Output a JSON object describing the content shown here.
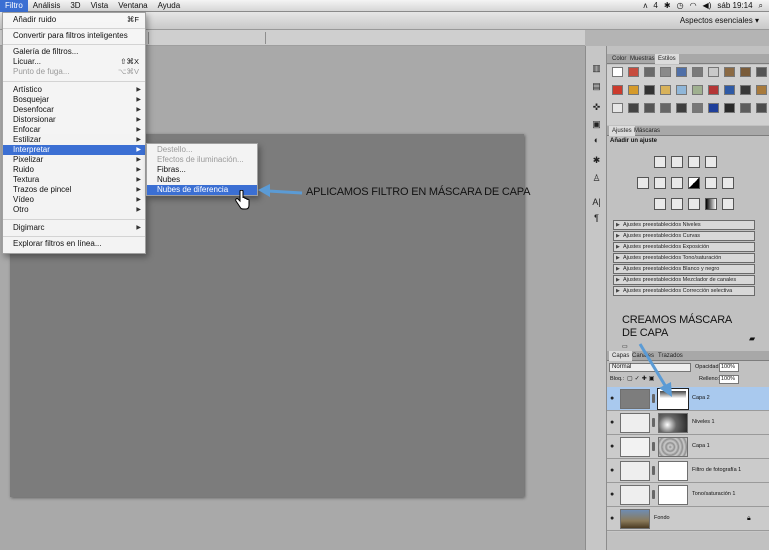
{
  "menubar": {
    "items": [
      "Filtro",
      "Análisis",
      "3D",
      "Vista",
      "Ventana",
      "Ayuda"
    ],
    "status": [
      "4",
      "sáb 19:14"
    ]
  },
  "appbar": {
    "workspace_label": "Aspectos esenciales ▾"
  },
  "filter_menu": {
    "top": [
      {
        "label": "Añadir ruido",
        "shortcut": "⌘F"
      },
      {
        "label": "Convertir para filtros inteligentes"
      },
      {
        "label": "Galería de filtros..."
      },
      {
        "label": "Licuar...",
        "shortcut": "⇧⌘X"
      },
      {
        "label": "Punto de fuga...",
        "shortcut": "⌥⌘V",
        "disabled": true
      }
    ],
    "groups": [
      "Artístico",
      "Bosquejar",
      "Desenfocar",
      "Distorsionar",
      "Enfocar",
      "Estilizar",
      "Interpretar",
      "Pixelizar",
      "Ruido",
      "Textura",
      "Trazos de pincel",
      "Vídeo",
      "Otro"
    ],
    "highlighted": "Interpretar",
    "bottom": [
      "Digimarc",
      "Explorar filtros en línea..."
    ]
  },
  "sub_menu": {
    "items": [
      {
        "label": "Destello...",
        "disabled": true
      },
      {
        "label": "Efectos de iluminación...",
        "disabled": true
      },
      {
        "label": "Fibras..."
      },
      {
        "label": "Nubes"
      },
      {
        "label": "Nubes de diferencia",
        "highlighted": true
      }
    ]
  },
  "annotations": {
    "apply": "APLICAMOS FILTRO EN MÁSCARA DE CAPA",
    "create_line1": "CREAMOS MÁSCARA",
    "create_line2": "DE CAPA"
  },
  "swatches_panel": {
    "tabs": [
      "Color",
      "Muestras",
      "Estilos"
    ],
    "active_tab": "Estilos"
  },
  "adjustments_panel": {
    "tabs": [
      "Ajustes",
      "Máscaras"
    ],
    "active_tab": "Ajustes",
    "heading": "Añadir un ajuste",
    "presets": [
      "Ajustes preestablecidos Niveles",
      "Ajustes preestablecidos Curvas",
      "Ajustes preestablecidos Exposición",
      "Ajustes preestablecidos Tono/saturación",
      "Ajustes preestablecidos Blanco y negro",
      "Ajustes preestablecidos Mezclador de canales",
      "Ajustes preestablecidos Corrección selectiva"
    ]
  },
  "layers_panel": {
    "tabs": [
      "Capas",
      "Canales",
      "Trazados"
    ],
    "active_tab": "Capas",
    "blend_mode": "Normal",
    "opacity_label": "Opacidad:",
    "opacity": "100%",
    "lock_label": "Bloq.:",
    "fill_label": "Relleno:",
    "fill": "100%",
    "layers": [
      {
        "name": "Capa 2",
        "selected": true
      },
      {
        "name": "Niveles 1"
      },
      {
        "name": "Capa 1"
      },
      {
        "name": "Filtro de fotografía 1"
      },
      {
        "name": "Tono/saturación 1"
      },
      {
        "name": "Fondo"
      }
    ]
  },
  "colors": {
    "menu_highlight": "#3b6fd3",
    "arrow": "#5b9bd5",
    "selected_layer": "#a9c9ee"
  }
}
